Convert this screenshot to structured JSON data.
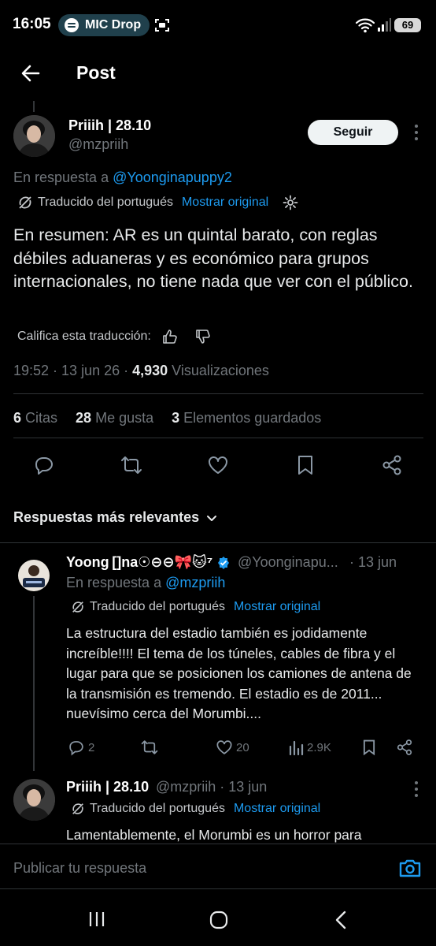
{
  "status_bar": {
    "time": "16:05",
    "media": "MIC Drop",
    "battery": "69",
    "icons": [
      "spotify-icon",
      "scan-icon",
      "wifi-icon",
      "signal-icon",
      "battery-icon"
    ]
  },
  "header": {
    "title": "Post",
    "back_icon": "arrow-left-icon"
  },
  "post": {
    "author_name": "Priiih | 28.10",
    "author_handle": "@mzpriih",
    "follow_label": "Seguir",
    "reply_prefix": "En respuesta a ",
    "reply_to": "@Yoonginapuppy2",
    "translated_label": "Traducido del portugués",
    "show_original": "Mostrar original",
    "text": "En resumen: AR es un quintal barato, con reglas débiles aduaneras y es económico para grupos internacionales, no tiene nada que ver con el público.",
    "rate_translation": "Califica esta traducción:",
    "timestamp": "19:52 · 13 jun 26 · ",
    "views_count": "4,930",
    "views_label": " Visualizaciones",
    "stats": {
      "quotes_count": "6",
      "quotes_label": " Citas",
      "likes_count": "28",
      "likes_label": " Me gusta",
      "bookmarks_count": "3",
      "bookmarks_label": " Elementos guardados"
    }
  },
  "replies_sort": {
    "label": "Respuestas más relevantes"
  },
  "replies": [
    {
      "name": "Yoong []na☉⊖⊖🎀🐱⁷",
      "handle": "@Yoonginapu...",
      "time": "· 13 jun",
      "reply_prefix": "En respuesta a ",
      "reply_to": "@mzpriih",
      "translated_label": "Traducido del portugués",
      "show_original": "Mostrar original",
      "text": "La estructura del estadio también es jodidamente increíble!!!! El tema de los túneles, cables de fibra y el lugar para que se posicionen los camiones de antena de la transmisión es tremendo. El estadio es de 2011... nuevísimo cerca del Morumbi....",
      "reply_count": "2",
      "like_count": "20",
      "view_count": "2.9K"
    },
    {
      "name": "Priiih | 28.10",
      "handle": "@mzpriih · 13 jun",
      "translated_label": "Traducido del portugués",
      "show_original": "Mostrar original",
      "text": "Lamentablemente, el Morumbi es un horror para"
    }
  ],
  "composer": {
    "placeholder": "Publicar tu respuesta"
  },
  "colors": {
    "accent": "#1d9bf0",
    "background": "#000000",
    "muted_text": "#71767b",
    "verified": "#1d9bf0"
  }
}
